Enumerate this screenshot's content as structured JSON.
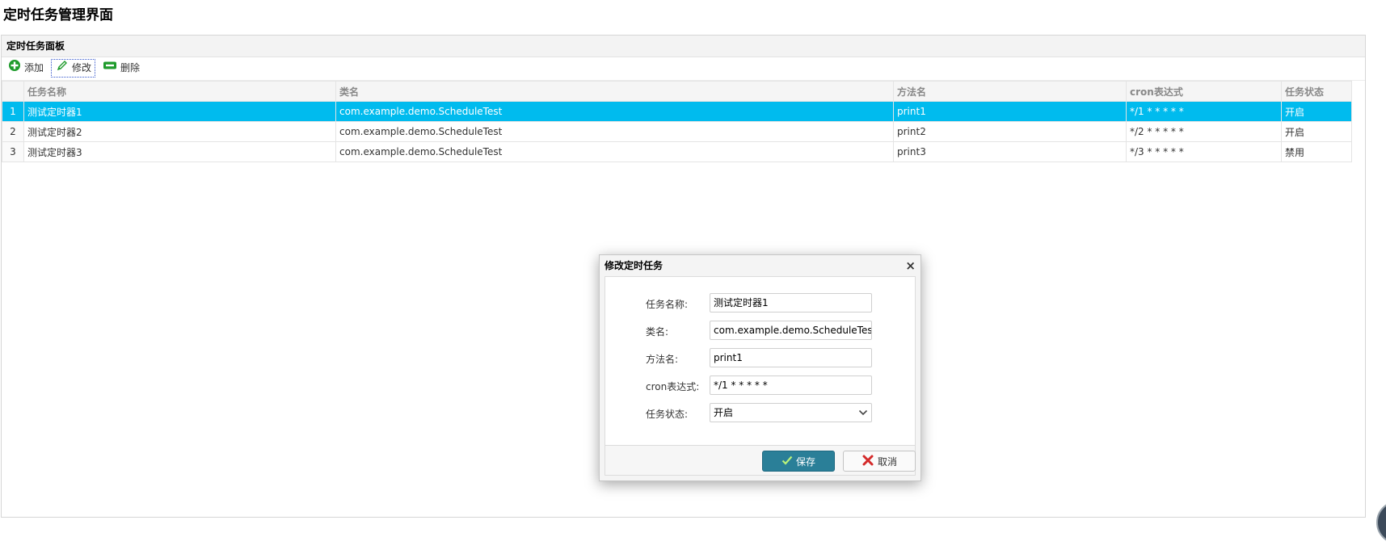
{
  "page": {
    "title": "定时任务管理界面"
  },
  "panel": {
    "title": "定时任务面板"
  },
  "toolbar": {
    "add_label": "添加",
    "edit_label": "修改",
    "delete_label": "删除"
  },
  "grid": {
    "columns": [
      "任务名称",
      "类名",
      "方法名",
      "cron表达式",
      "任务状态"
    ],
    "rows": [
      {
        "num": "1",
        "name": "测试定时器1",
        "class": "com.example.demo.ScheduleTest",
        "method": "print1",
        "cron": "*/1 * * * * *",
        "status": "开启",
        "selected": true
      },
      {
        "num": "2",
        "name": "测试定时器2",
        "class": "com.example.demo.ScheduleTest",
        "method": "print2",
        "cron": "*/2 * * * * *",
        "status": "开启",
        "selected": false
      },
      {
        "num": "3",
        "name": "测试定时器3",
        "class": "com.example.demo.ScheduleTest",
        "method": "print3",
        "cron": "*/3 * * * * *",
        "status": "禁用",
        "selected": false
      }
    ]
  },
  "dialog": {
    "title": "修改定时任务",
    "close_glyph": "×",
    "fields": {
      "name": {
        "label": "任务名称:",
        "value": "测试定时器1"
      },
      "class": {
        "label": "类名:",
        "value": "com.example.demo.ScheduleTest"
      },
      "method": {
        "label": "方法名:",
        "value": "print1"
      },
      "cron": {
        "label": "cron表达式:",
        "value": "*/1 * * * * *"
      },
      "status": {
        "label": "任务状态:",
        "value": "开启"
      }
    },
    "save_label": "保存",
    "cancel_label": "取消"
  },
  "icons": {
    "add": "plus-circle-icon",
    "edit": "pencil-icon",
    "delete": "minus-icon",
    "save": "check-icon",
    "cancel": "x-icon",
    "dropdown": "chevron-down-icon"
  },
  "colors": {
    "selected_row": "#00bbee",
    "save_button": "#2a7f98",
    "icon_green": "#1f9b2c",
    "cancel_red": "#d42a2a"
  }
}
